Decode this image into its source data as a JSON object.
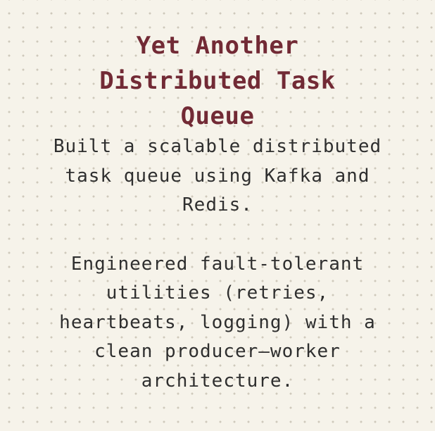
{
  "project": {
    "title": "Yet Another Distributed Task Queue",
    "paragraphs": [
      "Built a scalable distributed task queue using Kafka and Redis.",
      "Engineered fault-tolerant utilities (retries, heartbeats, logging) with a clean producer–worker architecture."
    ]
  },
  "colors": {
    "background": "#f6f3ea",
    "dot": "#cfc9bb",
    "title": "#722a35",
    "text": "#2f2f2f"
  }
}
